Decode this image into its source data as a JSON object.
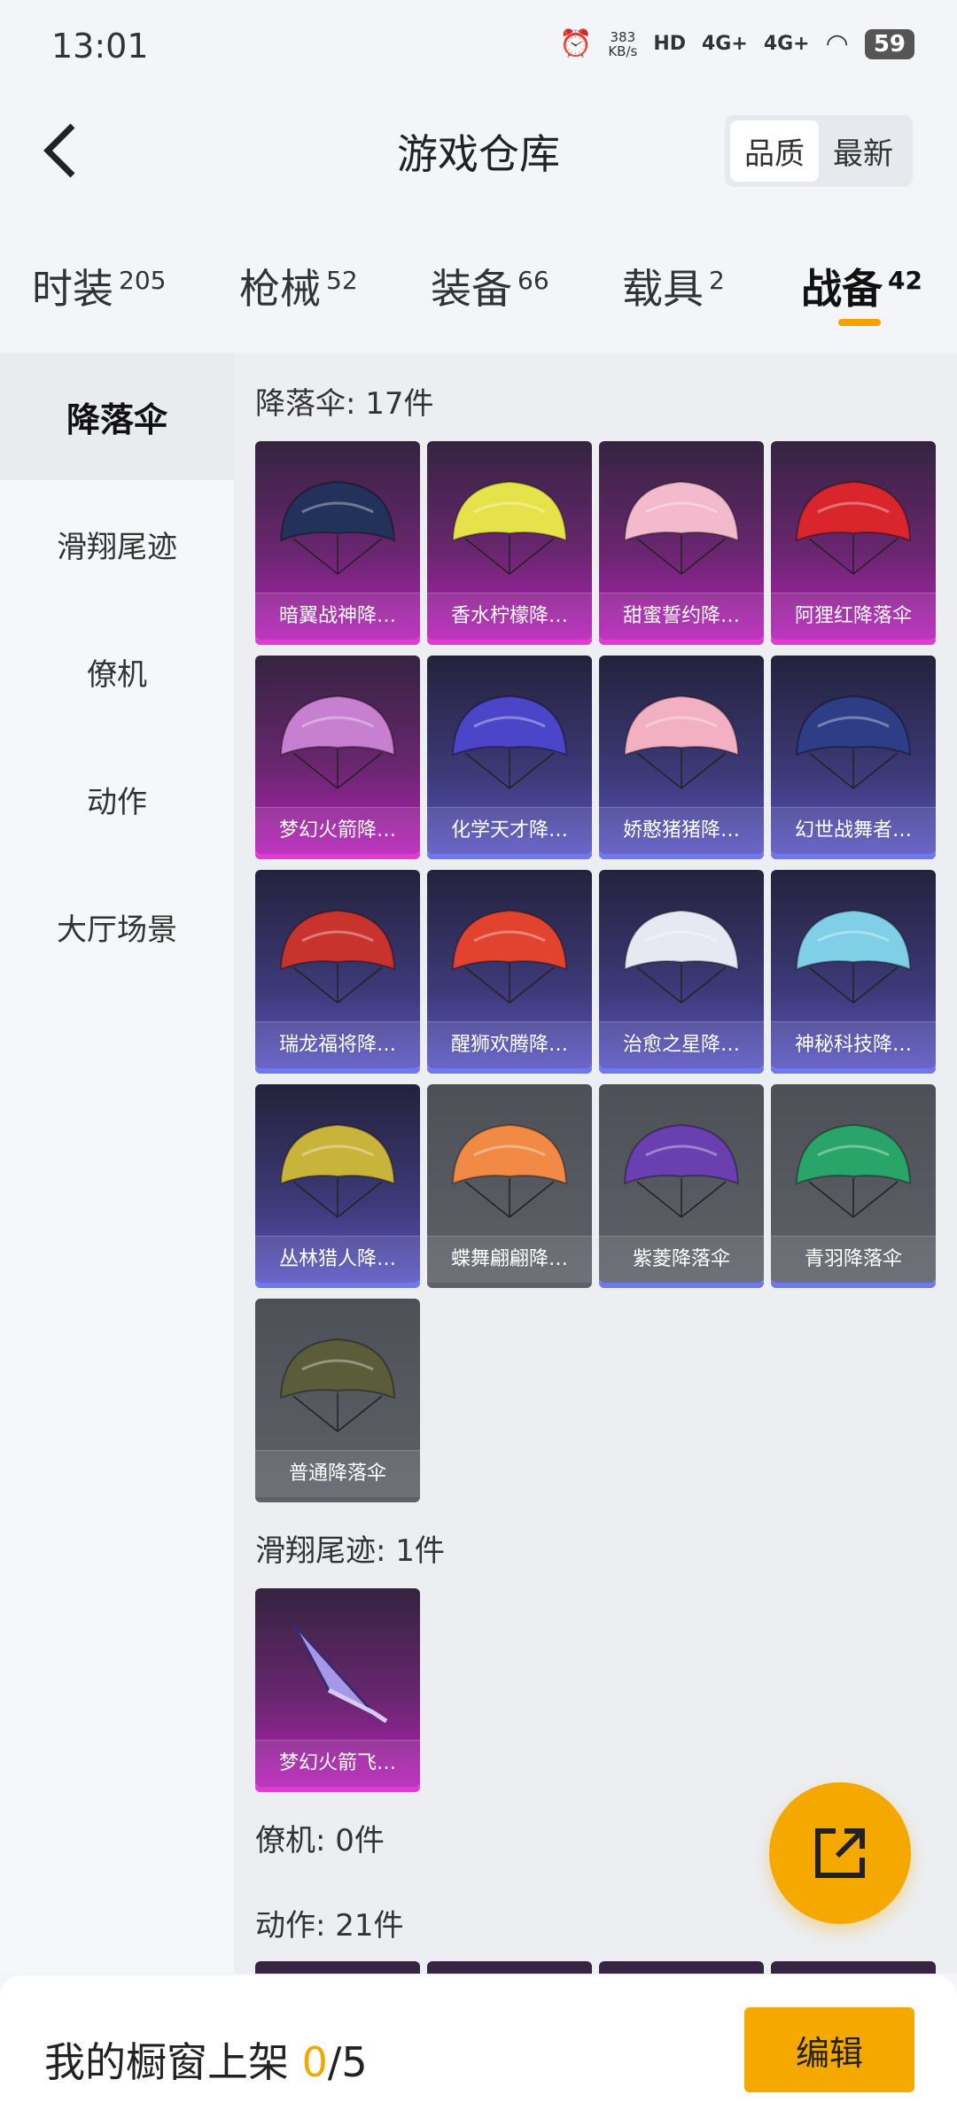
{
  "status_bar": {
    "time": "13:01",
    "net_speed_value": "383",
    "net_speed_unit": "KB/s",
    "hd": "HD",
    "sig1": "4G+",
    "sig2": "4G+",
    "battery": "59"
  },
  "header": {
    "title": "游戏仓库",
    "sort_quality": "品质",
    "sort_newest": "最新"
  },
  "tabs": [
    {
      "label": "时装",
      "count": "205"
    },
    {
      "label": "枪械",
      "count": "52"
    },
    {
      "label": "装备",
      "count": "66"
    },
    {
      "label": "载具",
      "count": "2"
    },
    {
      "label": "战备",
      "count": "42",
      "active": true
    }
  ],
  "sidebar": {
    "items": [
      {
        "label": "降落伞",
        "active": true
      },
      {
        "label": "滑翔尾迹"
      },
      {
        "label": "僚机"
      },
      {
        "label": "动作"
      },
      {
        "label": "大厅场景"
      }
    ]
  },
  "sections": {
    "parachute": {
      "title": "降落伞: 17件",
      "items": [
        {
          "name": "暗翼战神降…",
          "rarity": "purple",
          "color": "#22325a"
        },
        {
          "name": "香水柠檬降…",
          "rarity": "purple",
          "color": "#e6e24a"
        },
        {
          "name": "甜蜜誓约降…",
          "rarity": "purple",
          "color": "#f3b9cc"
        },
        {
          "name": "阿狸红降落伞",
          "rarity": "purple",
          "color": "#d8262c"
        },
        {
          "name": "梦幻火箭降…",
          "rarity": "purple",
          "color": "#c77fcf"
        },
        {
          "name": "化学天才降…",
          "rarity": "blue",
          "color": "#4b45c9"
        },
        {
          "name": "娇憨猪猪降…",
          "rarity": "blue",
          "color": "#f3b0c2"
        },
        {
          "name": "幻世战舞者…",
          "rarity": "blue",
          "color": "#2d3d86"
        },
        {
          "name": "瑞龙福将降…",
          "rarity": "blue",
          "color": "#c8342d"
        },
        {
          "name": "醒狮欢腾降…",
          "rarity": "blue",
          "color": "#e2432f"
        },
        {
          "name": "治愈之星降…",
          "rarity": "blue",
          "color": "#e6e8f2"
        },
        {
          "name": "神秘科技降…",
          "rarity": "blue",
          "color": "#7fd0e6"
        },
        {
          "name": "丛林猎人降…",
          "rarity": "blue",
          "color": "#c9b43b"
        },
        {
          "name": "蝶舞翩翩降…",
          "rarity": "gray",
          "color": "#f08a45"
        },
        {
          "name": "紫菱降落伞",
          "rarity": "gray-b",
          "color": "#6a3fb0"
        },
        {
          "name": "青羽降落伞",
          "rarity": "gray-b",
          "color": "#2aa56a"
        },
        {
          "name": "普通降落伞",
          "rarity": "gray",
          "color": "#5a5c3a"
        }
      ]
    },
    "trail": {
      "title": "滑翔尾迹: 1件",
      "items": [
        {
          "name": "梦幻火箭飞…",
          "rarity": "purple",
          "color": "#a697e8"
        }
      ]
    },
    "wingman": {
      "title": "僚机: 0件"
    },
    "emote": {
      "title": "动作: 21件"
    }
  },
  "bottom_bar": {
    "label": "我的橱窗上架",
    "current": "0",
    "total": "/5",
    "edit": "编辑"
  },
  "colors": {
    "accent": "#f5a800",
    "purple_rarity": "#e23ad3",
    "blue_rarity": "#6f78ee"
  }
}
